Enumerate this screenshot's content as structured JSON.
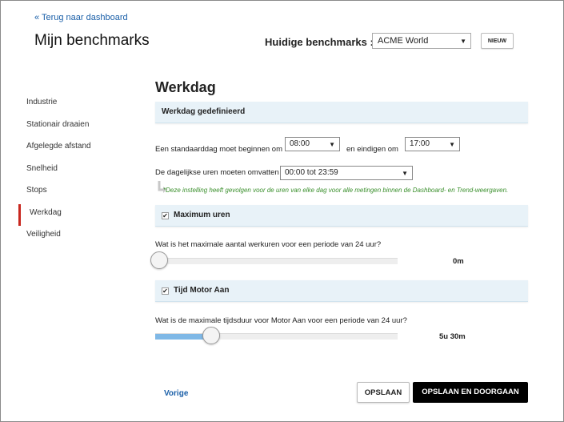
{
  "header": {
    "back_link": "« Terug naar dashboard",
    "title": "Mijn benchmarks",
    "benchmark_label": "Huidige benchmarks :",
    "benchmark_value": "ACME World",
    "new_button": "NIEUW"
  },
  "sidebar": {
    "items": [
      {
        "label": "Industrie"
      },
      {
        "label": "Stationair draaien"
      },
      {
        "label": "Afgelegde afstand"
      },
      {
        "label": "Snelheid"
      },
      {
        "label": "Stops"
      },
      {
        "label": "Werkdag",
        "active": true
      },
      {
        "label": "Veiligheid"
      }
    ]
  },
  "main": {
    "section_title": "Werkdag",
    "workday_panel": "Werkdag gedefinieerd",
    "start_label": "Een standaarddag moet beginnen om",
    "start_value": "08:00",
    "end_label": "en eindigen om",
    "end_value": "17:00",
    "hours_label": "De dagelijkse uren moeten omvatten",
    "hours_value": "00:00 tot 23:59",
    "note": "*Deze instelling heeft gevolgen voor de uren van elke dag voor alle metingen binnen de Dashboard- en Trend-weergaven.",
    "max_hours": {
      "title": "Maximum uren",
      "checked": true,
      "question": "Wat is het maximale aantal werkuren voor een periode van 24 uur?",
      "value_label": "0m",
      "fraction": 0.0
    },
    "motor_on": {
      "title": "Tijd Motor Aan",
      "checked": true,
      "question": "Wat is de maximale tijdsduur voor Motor Aan voor een periode van 24 uur?",
      "value_label": "5u 30m",
      "fraction": 0.23
    }
  },
  "footer": {
    "prev_link": "Vorige",
    "save": "OPSLAAN",
    "save_continue": "OPSLAAN EN DOORGAAN"
  },
  "colors": {
    "accent_red": "#c8271f",
    "link_blue": "#1a5fa8",
    "panel_bg": "#e8f2f8",
    "note_green": "#3a8f2c",
    "slider_fill": "#7fb8e6"
  }
}
